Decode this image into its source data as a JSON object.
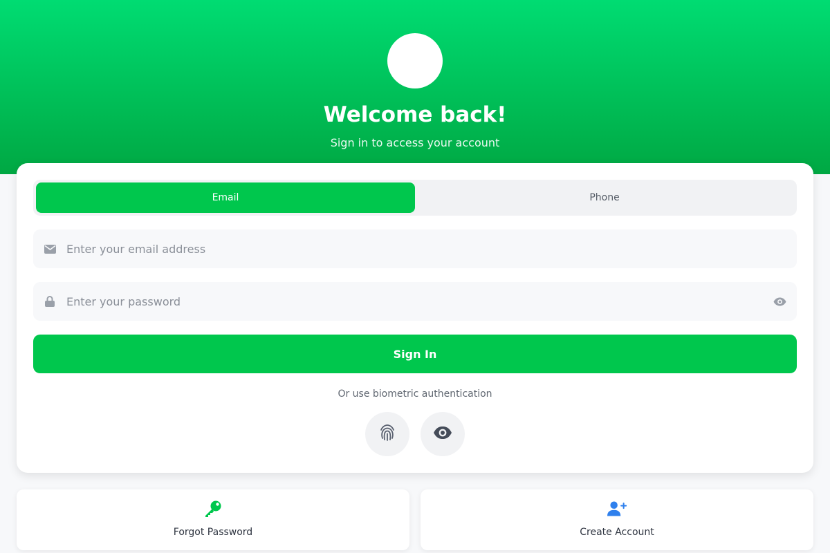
{
  "header": {
    "title": "Welcome back!",
    "subtitle": "Sign in to access your account"
  },
  "tabs": [
    {
      "label": "Email",
      "active": true
    },
    {
      "label": "Phone",
      "active": false
    }
  ],
  "form": {
    "email": {
      "value": "",
      "placeholder": "Enter your email address",
      "icon": "envelope-icon"
    },
    "password": {
      "value": "",
      "placeholder": "Enter your password",
      "icon": "lock-icon",
      "toggle_icon": "eye-icon"
    },
    "submit_label": "Sign In"
  },
  "biometric": {
    "label": "Or use biometric authentication",
    "options": [
      {
        "icon": "fingerprint-icon"
      },
      {
        "icon": "eye-icon"
      }
    ]
  },
  "links": [
    {
      "label": "Forgot Password",
      "icon": "key-icon",
      "color": "#00c74d"
    },
    {
      "label": "Create Account",
      "icon": "user-plus-icon",
      "color": "#2f80ed"
    }
  ],
  "colors": {
    "brand": "#00c74d",
    "gradient_top": "#00dc72",
    "gradient_bottom": "#00a843",
    "accent_blue": "#2f80ed"
  }
}
